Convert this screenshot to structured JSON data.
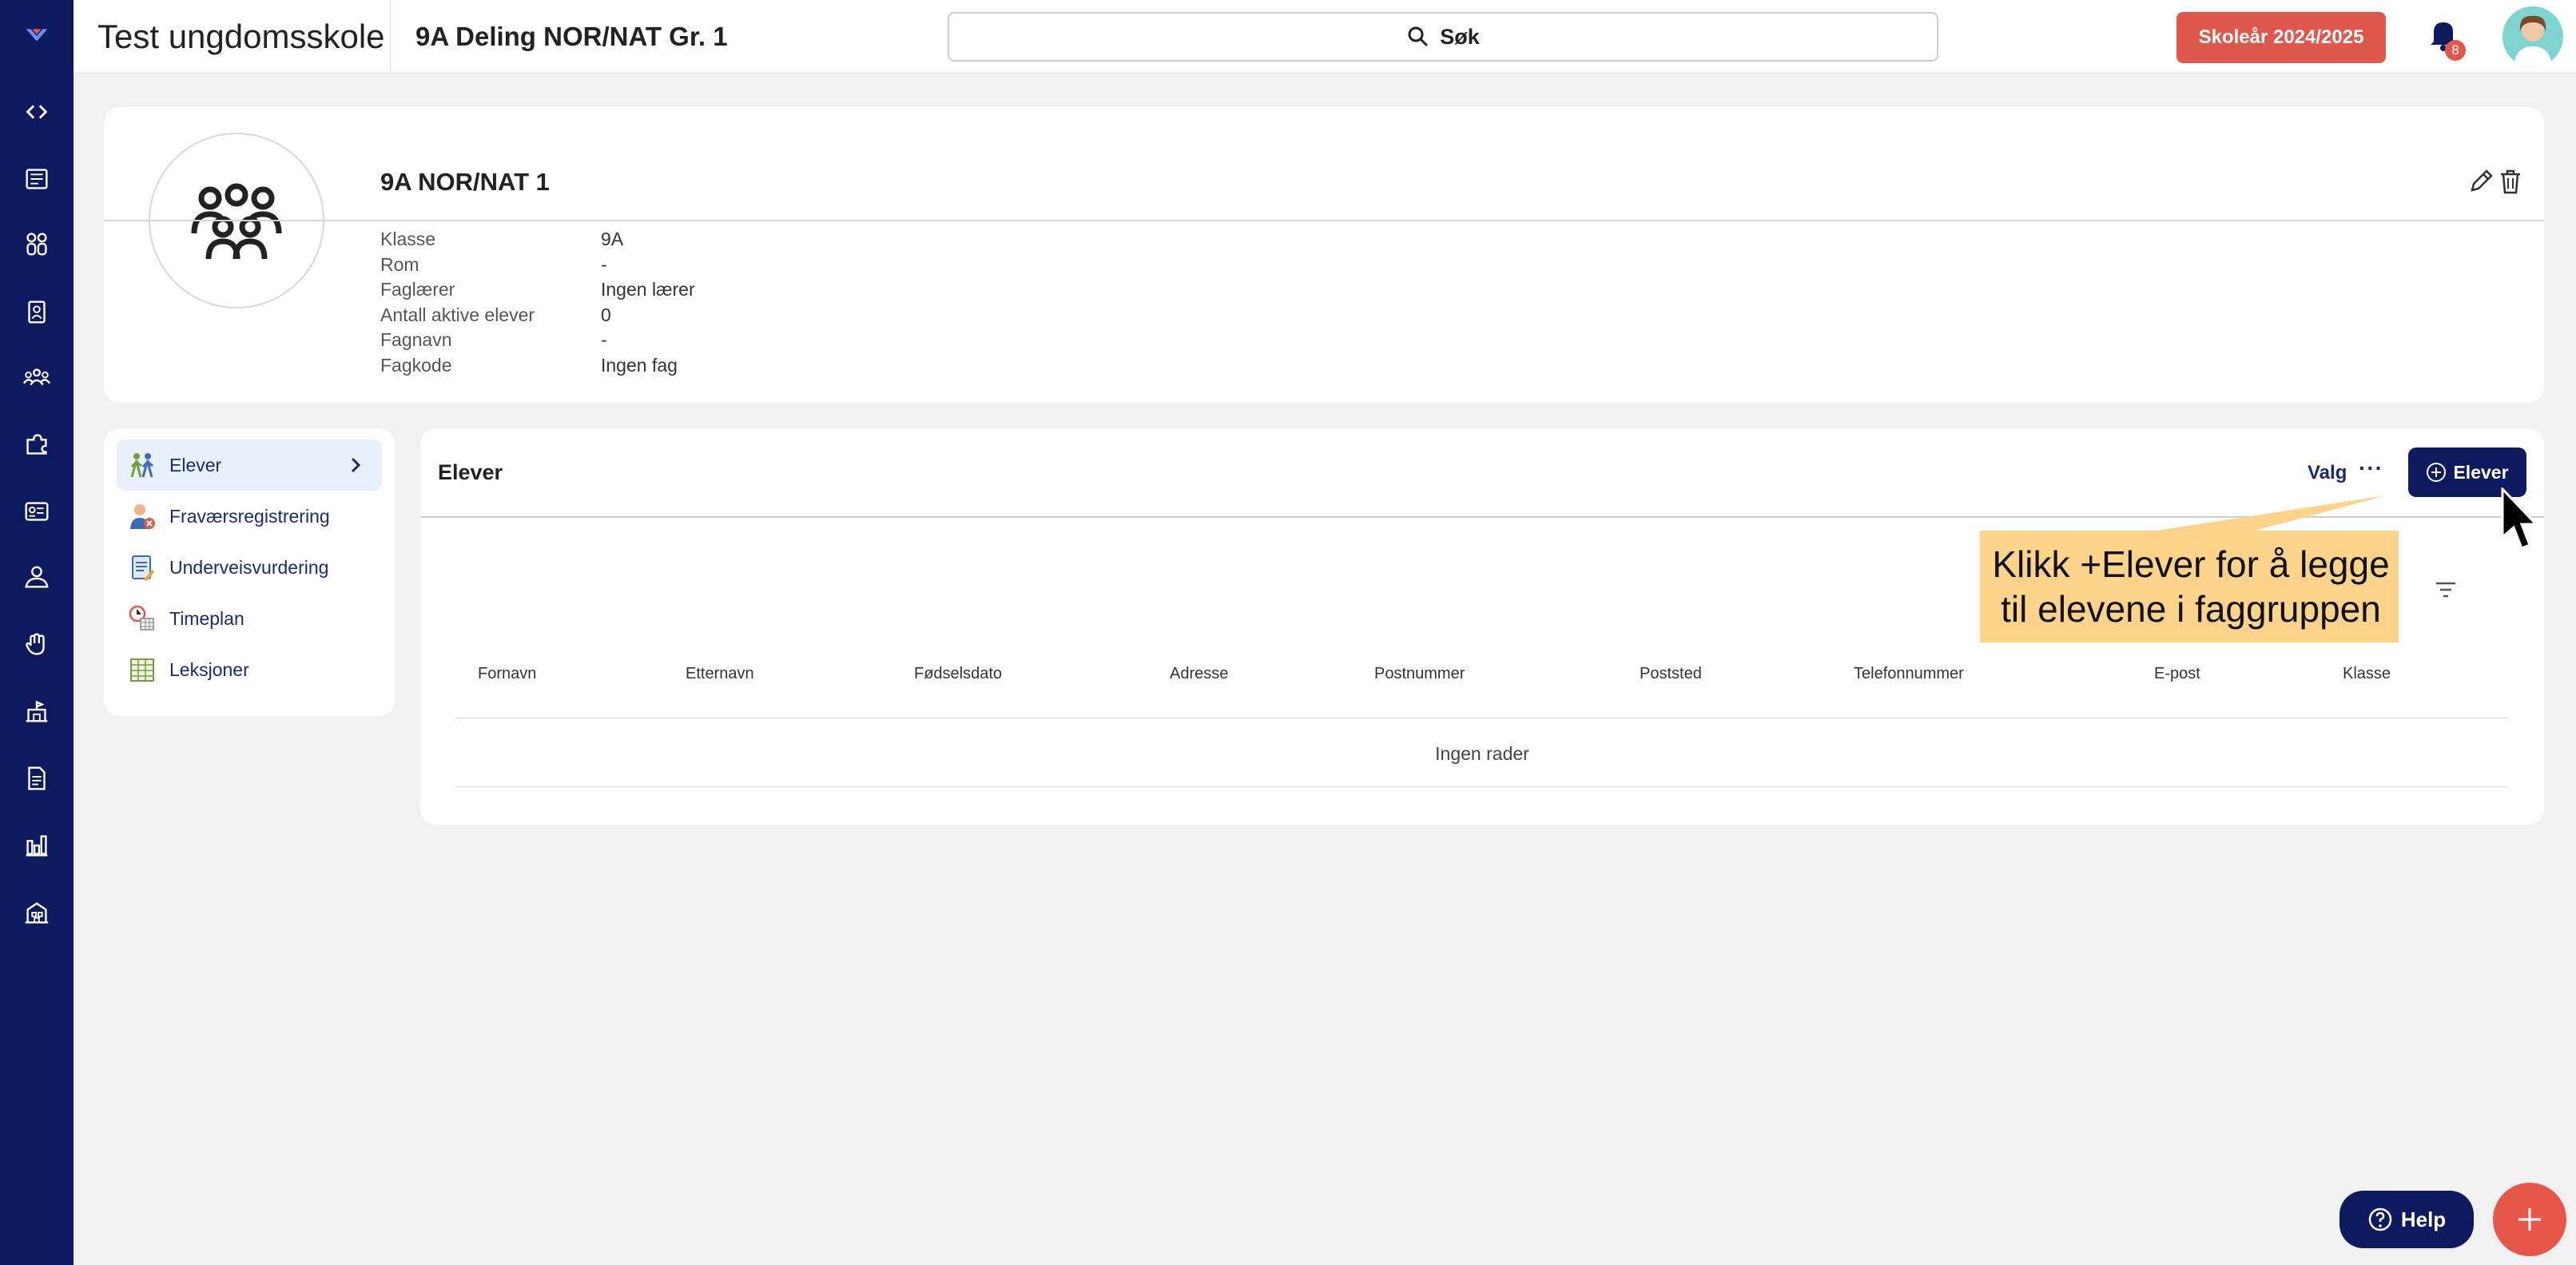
{
  "header": {
    "school_name": "Test ungdomsskole",
    "group_title": "9A Deling NOR/NAT Gr. 1",
    "search_label": "Søk",
    "school_year": "Skoleår 2024/2025",
    "notification_count": "8"
  },
  "nav": {
    "items": [
      "toggle-icon",
      "news-icon",
      "students-icon",
      "clipboard-icon",
      "groups-icon",
      "puzzle-icon",
      "report-icon",
      "user-icon",
      "hand-icon",
      "school-icon",
      "document-icon",
      "chart-icon",
      "building-icon"
    ]
  },
  "card": {
    "title": "9A NOR/NAT 1",
    "details": [
      {
        "label": "Klasse",
        "value": "9A"
      },
      {
        "label": "Rom",
        "value": "-"
      },
      {
        "label": "Faglærer",
        "value": "Ingen lærer"
      },
      {
        "label": "Antall aktive elever",
        "value": "0"
      },
      {
        "label": "Fagnavn",
        "value": "-"
      },
      {
        "label": "Fagkode",
        "value": "Ingen fag"
      }
    ]
  },
  "menu": {
    "items": [
      {
        "label": "Elever"
      },
      {
        "label": "Fraværsregistrering"
      },
      {
        "label": "Underveisvurdering"
      },
      {
        "label": "Timeplan"
      },
      {
        "label": "Leksjoner"
      }
    ]
  },
  "panel": {
    "title": "Elever",
    "valg_label": "Valg",
    "more_label": "···",
    "add_label": "Elever",
    "columns": [
      "Fornavn",
      "Etternavn",
      "Fødselsdato",
      "Adresse",
      "Postnummer",
      "Poststed",
      "Telefonnummer",
      "E-post",
      "Klasse"
    ],
    "empty_text": "Ingen rader"
  },
  "callout": {
    "line1": "Klikk +Elever for å legge",
    "line2": "til elevene i faggruppen"
  },
  "help": {
    "label": "Help"
  },
  "colors": {
    "nav_bg": "#0d1b5e",
    "accent_red": "#e0574b",
    "callout_bg": "#fbd38a"
  }
}
